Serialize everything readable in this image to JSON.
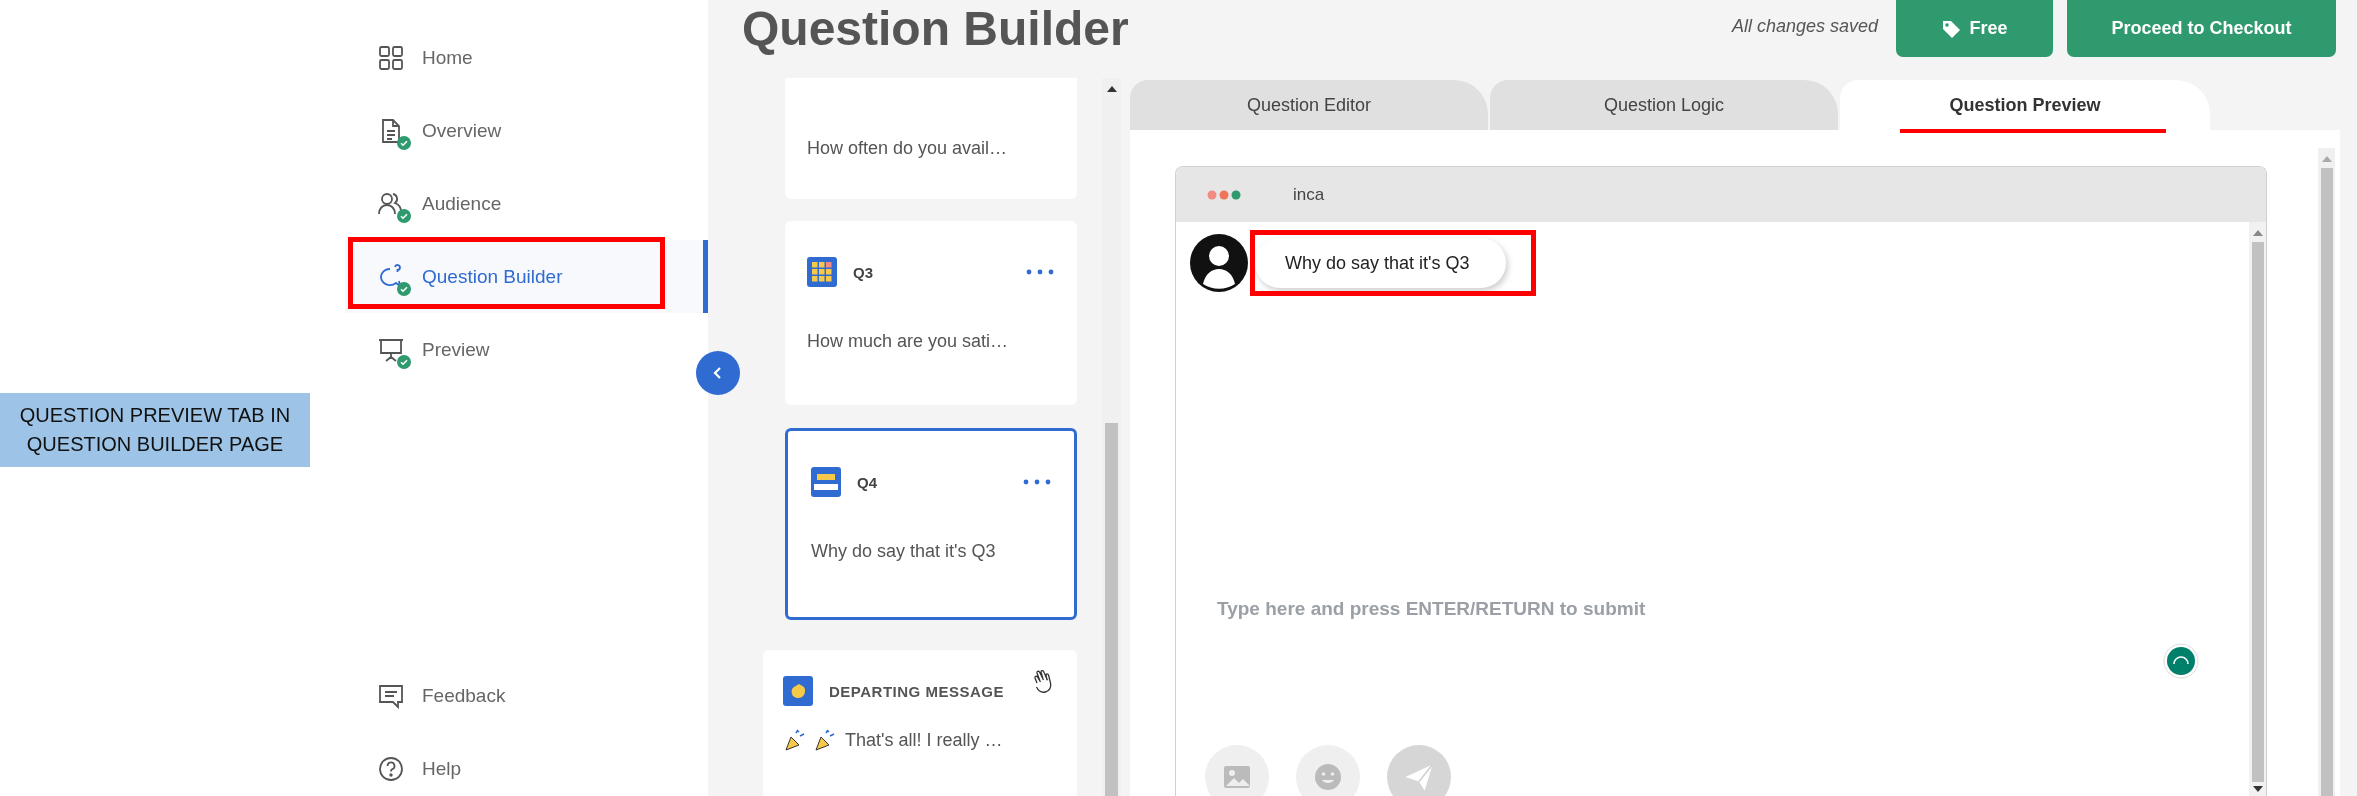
{
  "caption": "QUESTION PREVIEW TAB IN QUESTION BUILDER PAGE",
  "sidebar": {
    "items": [
      {
        "label": "Home",
        "kind": "grid",
        "done": false,
        "selected": false,
        "highlighted": false
      },
      {
        "label": "Overview",
        "kind": "document",
        "done": true,
        "selected": false,
        "highlighted": false
      },
      {
        "label": "Audience",
        "kind": "people",
        "done": true,
        "selected": false,
        "highlighted": false
      },
      {
        "label": "Question Builder",
        "kind": "question",
        "done": true,
        "selected": true,
        "highlighted": true
      },
      {
        "label": "Preview",
        "kind": "presentation",
        "done": true,
        "selected": false,
        "highlighted": false
      }
    ],
    "footer": [
      {
        "label": "Feedback",
        "kind": "feedback"
      },
      {
        "label": "Help",
        "kind": "help"
      }
    ]
  },
  "header": {
    "title": "Question Builder",
    "save_status": "All changes saved",
    "buttons": [
      {
        "label": "Free",
        "kind": "tag"
      },
      {
        "label": "Proceed to Checkout",
        "kind": "plain"
      }
    ]
  },
  "questions": [
    {
      "text": "How often do you avail…",
      "selected": false
    },
    {
      "kind": "grid",
      "number": "Q3",
      "text": "How much are you sati…",
      "selected": false
    },
    {
      "kind": "textbox",
      "number": "Q4",
      "text": "Why do say that it's Q3",
      "selected": true
    }
  ],
  "departing": {
    "title": "DEPARTING MESSAGE",
    "text": "That's all! I really …"
  },
  "tabs": [
    {
      "label": "Question Editor",
      "selected": false,
      "highlighted": false
    },
    {
      "label": "Question Logic",
      "selected": false,
      "highlighted": false
    },
    {
      "label": "Question Preview",
      "selected": true,
      "highlighted": true
    }
  ],
  "chat": {
    "title": "inca",
    "messages": [
      {
        "text": "Why do say that it's Q3",
        "highlighted": true
      }
    ],
    "input": {
      "placeholder": "Type here and press ENTER/RETURN to submit"
    }
  }
}
